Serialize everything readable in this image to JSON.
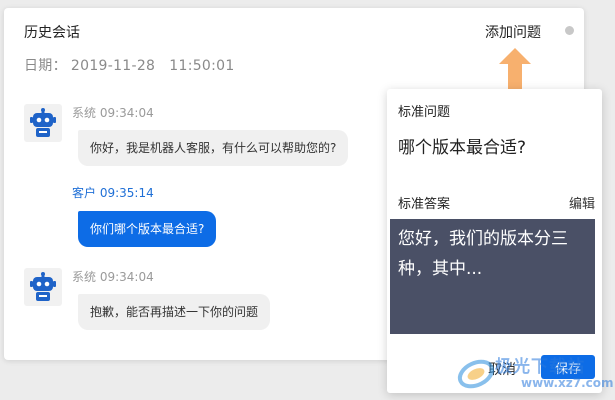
{
  "history": {
    "title": "历史会话",
    "add_question_label": "添加问题",
    "date_label": "日期：",
    "date_value": "2019-11-28",
    "time_value": "11:50:01"
  },
  "messages": [
    {
      "sender": "系统",
      "time": "09:34:04",
      "text": "你好，我是机器人客服，有什么可以帮助您的?"
    },
    {
      "sender": "客户",
      "time": "09:35:14",
      "text": "你们哪个版本最合适?"
    },
    {
      "sender": "系统",
      "time": "09:34:04",
      "text": "抱歉，能否再描述一下你的问题"
    }
  ],
  "panel": {
    "question_label": "标准问题",
    "question_text": "哪个版本最合适?",
    "answer_label": "标准答案",
    "edit_label": "编辑",
    "answer_text": "您好，我们的版本分三种，其中...",
    "cancel_label": "取消",
    "save_label": "保存"
  },
  "watermark": {
    "text": "极光下载站",
    "url": "www.xz7.com"
  },
  "colors": {
    "accent": "#0d6ce6",
    "arrow": "#f7b06e",
    "answer_bg": "#4a5066",
    "customer_name": "#1f6fd6"
  },
  "icons": {
    "bot_avatar": "robot-icon",
    "status": "status-dot"
  }
}
